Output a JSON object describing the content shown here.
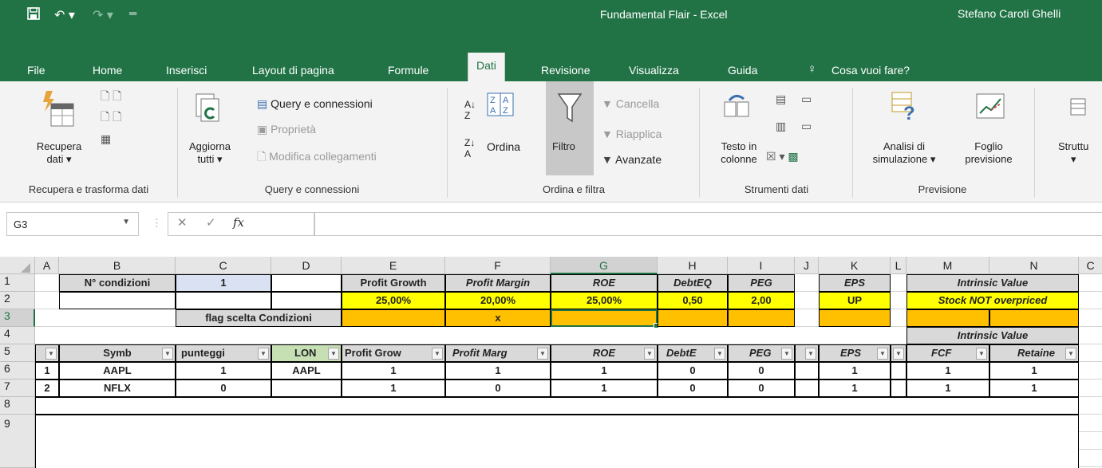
{
  "window": {
    "title": "Fundamental Flair  -  Excel",
    "user": "Stefano Caroti Ghelli"
  },
  "tabs": [
    "File",
    "Home",
    "Inserisci",
    "Layout di pagina",
    "Formule",
    "Dati",
    "Revisione",
    "Visualizza",
    "Guida",
    "Cosa vuoi fare?"
  ],
  "ribbon": {
    "recupera": "Recupera dati",
    "recupera_l1": "Recupera",
    "recupera_l2": "dati",
    "group1": "Recupera e trasforma dati",
    "aggiorna_l1": "Aggiorna",
    "aggiorna_l2": "tutti",
    "query_conn": "Query e connessioni",
    "proprieta": "Proprietà",
    "modifica": "Modifica collegamenti",
    "group2": "Query e connessioni",
    "ordina": "Ordina",
    "filtro": "Filtro",
    "cancella": "Cancella",
    "riapplica": "Riapplica",
    "avanzate": "Avanzate",
    "group3": "Ordina e filtra",
    "testo_l1": "Testo in",
    "testo_l2": "colonne",
    "group4": "Strumenti dati",
    "analisi_l1": "Analisi di",
    "analisi_l2": "simulazione",
    "foglio_l1": "Foglio",
    "foglio_l2": "previsione",
    "group5": "Previsione",
    "struttura": "Struttu"
  },
  "namebox": "G3",
  "fx": "fx",
  "columns": [
    "A",
    "B",
    "C",
    "D",
    "E",
    "F",
    "G",
    "H",
    "I",
    "J",
    "K",
    "L",
    "M",
    "N",
    "C"
  ],
  "rows": [
    "1",
    "2",
    "3",
    "4",
    "5",
    "6",
    "7",
    "8",
    "9"
  ],
  "cells": {
    "B1": "N° condizioni",
    "C1": "1",
    "E1": "Profit Growth",
    "F1": "Profit Margin",
    "G1": "ROE",
    "H1": "DebtEQ",
    "I1": "PEG",
    "K1": "EPS",
    "MN1": "Intrinsic Value",
    "E2": "25,00%",
    "F2": "20,00%",
    "G2": "25,00%",
    "H2": "0,50",
    "I2": "2,00",
    "K2": "UP",
    "MN2": "Stock NOT overpriced",
    "BC3": "flag scelta Condizioni",
    "F3": "x",
    "MN4": "Intrinsic Value",
    "B5": "Symb",
    "C5": "punteggi",
    "D5": "LON",
    "E5": "Profit Grow",
    "F5": "Profit Marg",
    "G5": "ROE",
    "H5": "DebtE",
    "I5": "PEG",
    "K5": "EPS",
    "M5": "FCF",
    "N5": "Retaine",
    "A6": "1",
    "B6": "AAPL",
    "C6": "1",
    "D6": "AAPL",
    "E6": "1",
    "F6": "1",
    "G6": "1",
    "H6": "0",
    "I6": "0",
    "K6": "1",
    "M6": "1",
    "N6": "1",
    "A7": "2",
    "B7": "NFLX",
    "C7": "0",
    "D7": "",
    "E7": "1",
    "F7": "0",
    "G7": "1",
    "H7": "0",
    "I7": "0",
    "K7": "1",
    "M7": "1",
    "N7": "1"
  }
}
